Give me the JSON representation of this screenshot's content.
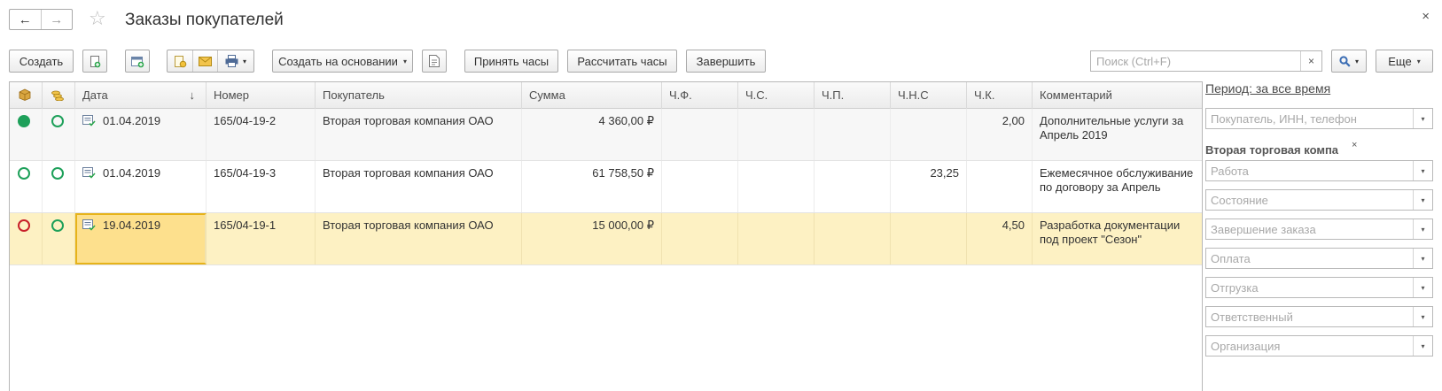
{
  "window": {
    "title": "Заказы покупателей",
    "back_icon": "←",
    "forward_icon": "→",
    "star_icon": "☆",
    "close_icon": "×"
  },
  "toolbar": {
    "create": "Создать",
    "create_based_on": "Создать на основании",
    "accept_hours": "Принять часы",
    "calc_hours": "Рассчитать часы",
    "finish": "Завершить",
    "more": "Еще",
    "dropdown_glyph": "▾"
  },
  "search": {
    "placeholder": "Поиск (Ctrl+F)",
    "clear": "×"
  },
  "table": {
    "columns": [
      "",
      "",
      "Дата",
      "Номер",
      "Покупатель",
      "Сумма",
      "Ч.Ф.",
      "Ч.С.",
      "Ч.П.",
      "Ч.Н.С",
      "Ч.К.",
      "Комментарий"
    ],
    "sort_indicator": "↓",
    "rows": [
      {
        "status1": "filled-green",
        "status2": "outline-green",
        "date": "01.04.2019",
        "number": "165/04-19-2",
        "customer": "Вторая торговая компания ОАО",
        "amount": "4 360,00 ₽",
        "chf": "",
        "chs": "",
        "chp": "",
        "chns": "",
        "chk": "2,00",
        "comment": "Дополнительные услуги за Апрель 2019"
      },
      {
        "status1": "outline-green",
        "status2": "outline-green",
        "date": "01.04.2019",
        "number": "165/04-19-3",
        "customer": "Вторая торговая компания ОАО",
        "amount": "61 758,50 ₽",
        "chf": "",
        "chs": "",
        "chp": "",
        "chns": "23,25",
        "chk": "",
        "comment": "Ежемесячное обслуживание по договору за Апрель"
      },
      {
        "status1": "outline-red",
        "status2": "outline-green",
        "date": "19.04.2019",
        "number": "165/04-19-1",
        "customer": "Вторая торговая компания ОАО",
        "amount": "15 000,00 ₽",
        "chf": "",
        "chs": "",
        "chp": "",
        "chns": "",
        "chk": "4,50",
        "comment": "Разработка документации под проект \"Сезон\""
      }
    ]
  },
  "filters": {
    "period": "Период: за все время",
    "customer_placeholder": "Покупатель, ИНН, телефон",
    "selected_customer": "Вторая торговая компа",
    "selected_customer_clear": "×",
    "fields": [
      "Работа",
      "Состояние",
      "Завершение заказа",
      "Оплата",
      "Отгрузка",
      "Ответственный",
      "Организация"
    ]
  },
  "colors": {
    "selected_row": "#fdf1c3",
    "focus_cell": "#fde08d",
    "status_green": "#1ea05a",
    "status_red": "#c8202a"
  }
}
